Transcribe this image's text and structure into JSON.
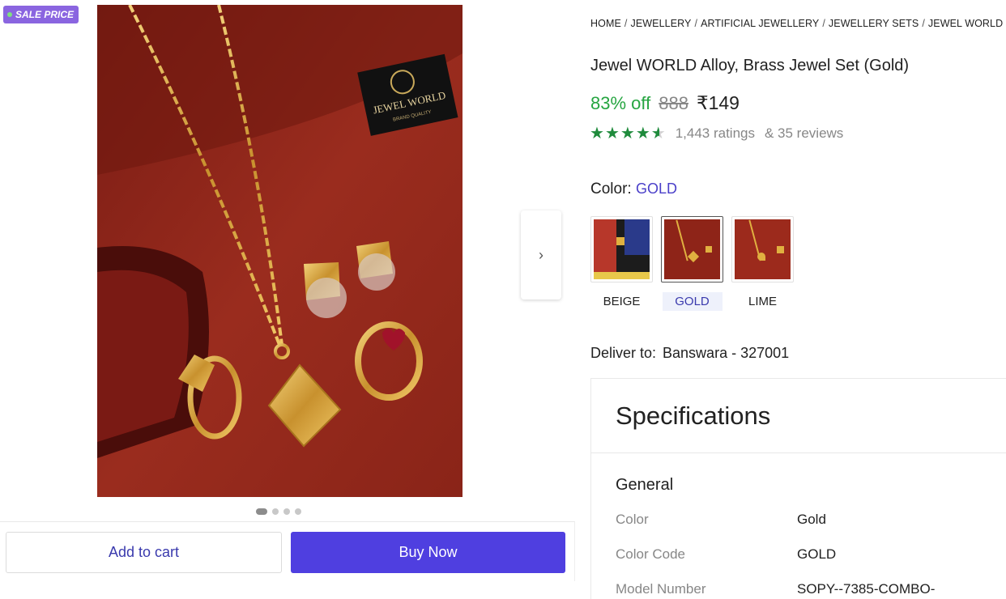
{
  "badge": {
    "label": "SALE PRICE"
  },
  "gallery": {
    "image_label": "Jewel WORLD Alloy, Brass Jewel Set (Gold) product photo",
    "logo_line1": "JEWEL WORLD",
    "logo_line2": "BRAND QUALITY",
    "dots": 4,
    "active_dot": 0
  },
  "actions": {
    "add_to_cart": "Add to cart",
    "buy_now": "Buy Now"
  },
  "breadcrumb": [
    "HOME",
    "JEWELLERY",
    "ARTIFICIAL JEWELLERY",
    "JEWELLERY SETS",
    "JEWEL WORLD JE"
  ],
  "product": {
    "title": "Jewel WORLD Alloy, Brass Jewel Set (Gold)",
    "discount": "83% off",
    "mrp": "888",
    "price": "₹149",
    "rating_stars": 4.5,
    "ratings": "1,443 ratings",
    "reviews": "& 35 reviews"
  },
  "color": {
    "label": "Color:",
    "selected": "GOLD",
    "options": [
      {
        "label": "BEIGE"
      },
      {
        "label": "GOLD"
      },
      {
        "label": "LIME"
      }
    ]
  },
  "delivery": {
    "label": "Deliver to:",
    "location": "Banswara - 327001"
  },
  "specs": {
    "title": "Specifications",
    "section": "General",
    "rows": [
      {
        "key": "Color",
        "value": "Gold"
      },
      {
        "key": "Color Code",
        "value": "GOLD"
      },
      {
        "key": "Model Number",
        "value": "SOPY--7385-COMBO-"
      }
    ]
  },
  "colors": {
    "accent": "#4f3fe0",
    "discount": "#26a541",
    "star": "#1f8b3c",
    "badge": "#8a65e0",
    "product_bg": "#8e2418"
  }
}
